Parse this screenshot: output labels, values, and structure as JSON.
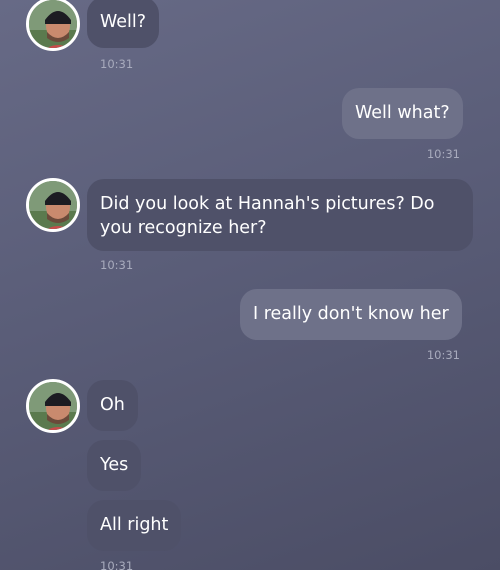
{
  "messages": [
    {
      "sender": "them",
      "lines": [
        "Well?"
      ],
      "time": "10:31"
    },
    {
      "sender": "me",
      "lines": [
        "Well what?"
      ],
      "time": "10:31"
    },
    {
      "sender": "them",
      "lines": [
        "Did you look at Hannah's pictures? Do you recognize her?"
      ],
      "time": "10:31"
    },
    {
      "sender": "me",
      "lines": [
        "I really don't know her"
      ],
      "time": "10:31"
    },
    {
      "sender": "them",
      "lines": [
        "Oh",
        "Yes",
        "All right"
      ],
      "time": "10:31"
    }
  ],
  "colors": {
    "incoming_bubble": "#4f5169",
    "outgoing_bubble": "#6e7189",
    "timestamp": "#a8abbd"
  }
}
